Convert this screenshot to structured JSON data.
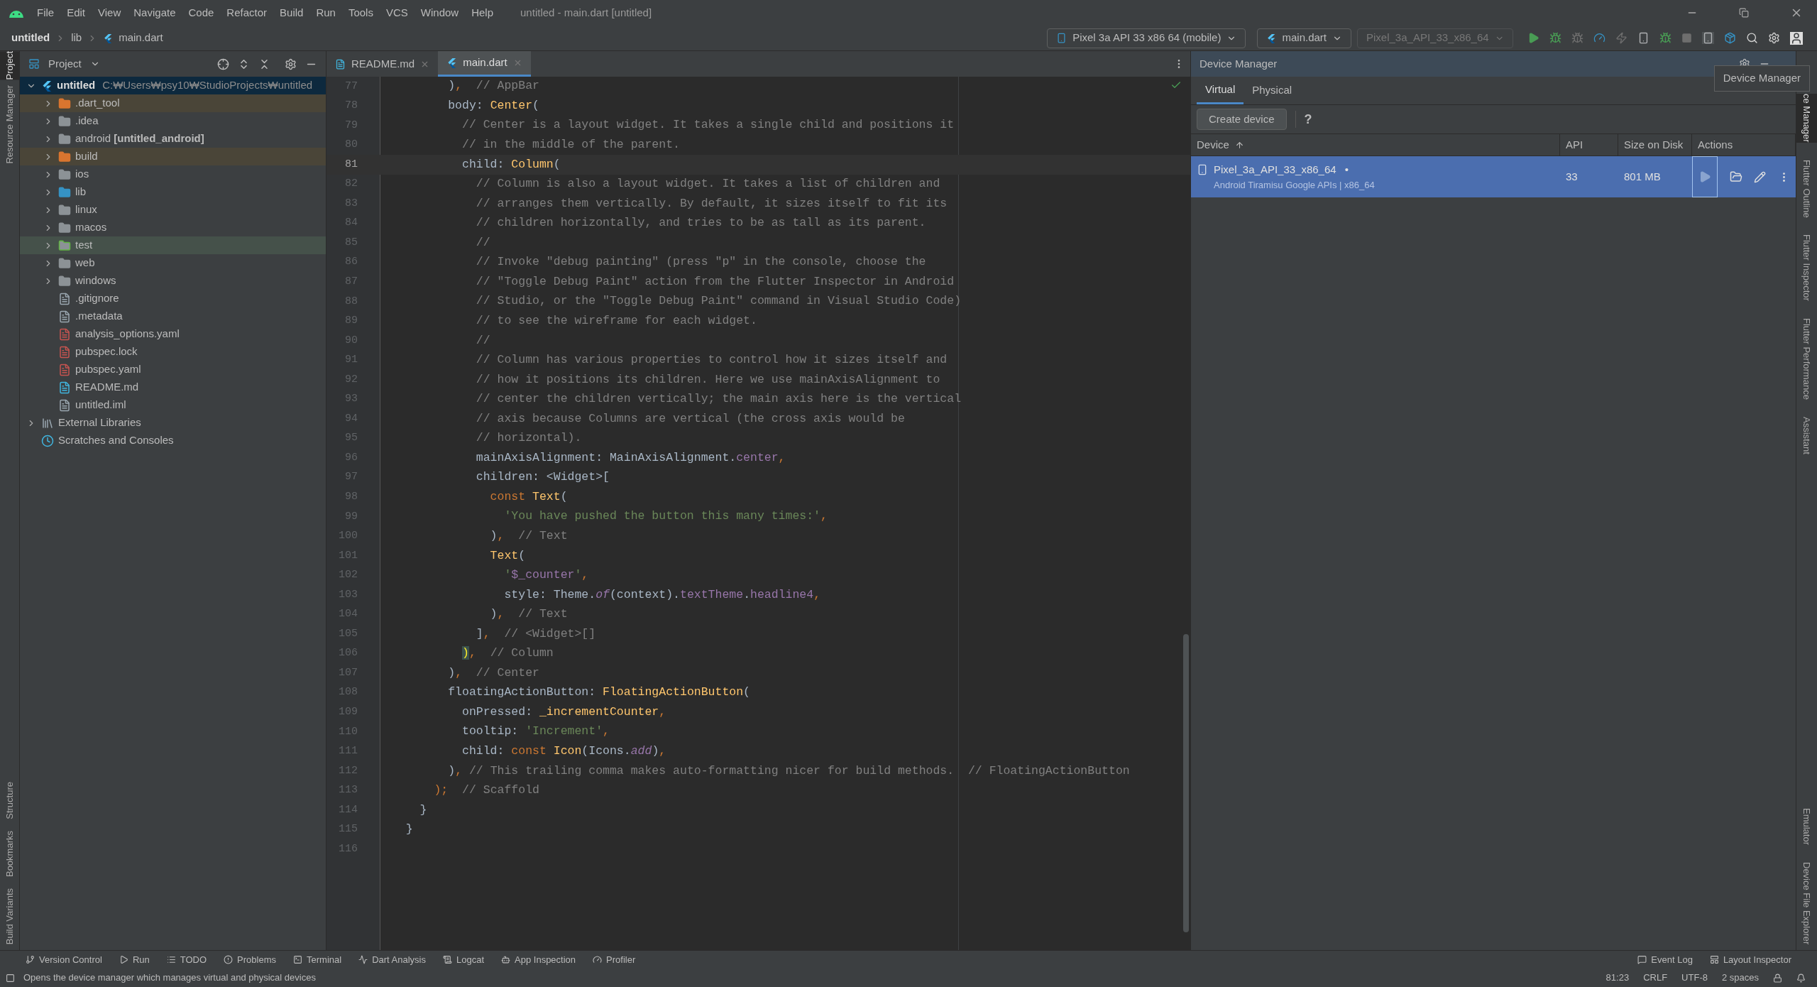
{
  "menu_bar": {
    "items": [
      "File",
      "Edit",
      "View",
      "Navigate",
      "Code",
      "Refactor",
      "Build",
      "Run",
      "Tools",
      "VCS",
      "Window",
      "Help"
    ],
    "title": "untitled - main.dart [untitled]"
  },
  "nav_bar": {
    "breadcrumbs": [
      "untitled",
      "lib",
      "main.dart"
    ],
    "device_select": "Pixel 3a API 33 x86 64 (mobile)",
    "config_select": "main.dart",
    "target_select": "Pixel_3a_API_33_x86_64"
  },
  "left_strip": {
    "top": [
      {
        "label": "Project",
        "selected": true
      },
      {
        "label": "Resource Manager",
        "selected": false
      }
    ],
    "bottom": [
      {
        "label": "Structure",
        "selected": false
      },
      {
        "label": "Bookmarks",
        "selected": false
      },
      {
        "label": "Build Variants",
        "selected": false
      }
    ]
  },
  "project_panel": {
    "title": "Project",
    "tree": [
      {
        "label": "untitled",
        "path": "C:₩Users₩psy10₩StudioProjects₩untitled",
        "kind": "flutter",
        "expanded": true,
        "selected": true,
        "children": [
          {
            "label": ".dart_tool",
            "kind": "excluded_folder",
            "expanded": false,
            "selected": false
          },
          {
            "label": ".idea",
            "kind": "folder",
            "expanded": false,
            "selected": false
          },
          {
            "label": "android **[untitled_android]**",
            "kind": "folder",
            "expanded": false,
            "selected": false
          },
          {
            "label": "build",
            "kind": "excluded_folder",
            "expanded": false,
            "selected": false
          },
          {
            "label": "ios",
            "kind": "folder",
            "expanded": false,
            "selected": false
          },
          {
            "label": "lib",
            "kind": "source",
            "expanded": false,
            "selected": false
          },
          {
            "label": "linux",
            "kind": "folder",
            "expanded": false,
            "selected": false
          },
          {
            "label": "macos",
            "kind": "folder",
            "expanded": false,
            "selected": false
          },
          {
            "label": "test",
            "kind": "test_folder",
            "expanded": false,
            "selected": false
          },
          {
            "label": "web",
            "kind": "folder",
            "expanded": false,
            "selected": false
          },
          {
            "label": "windows",
            "kind": "folder",
            "expanded": false,
            "selected": false
          },
          {
            "label": ".gitignore",
            "kind": "file",
            "selected": false
          },
          {
            "label": ".metadata",
            "kind": "file",
            "selected": false
          },
          {
            "label": "analysis_options.yaml",
            "kind": "yaml",
            "selected": false
          },
          {
            "label": "pubspec.lock",
            "kind": "yaml",
            "selected": false
          },
          {
            "label": "pubspec.yaml",
            "kind": "yaml",
            "selected": false
          },
          {
            "label": "README.md",
            "kind": "markdown",
            "selected": false
          },
          {
            "label": "untitled.iml",
            "kind": "file",
            "selected": false
          }
        ]
      },
      {
        "label": "External Libraries",
        "kind": "libraries",
        "expanded": false,
        "selected": false
      },
      {
        "label": "Scratches and Consoles",
        "kind": "scratches",
        "selected": false
      }
    ]
  },
  "editor": {
    "tabs": [
      {
        "label": "README.md",
        "kind": "markdown",
        "selected": false
      },
      {
        "label": "main.dart",
        "kind": "dart",
        "selected": true
      }
    ],
    "lines": [
      {
        "number": "77",
        "current": false,
        "tokens": [
          {
            "kind": "plain",
            "text": "        )"
          },
          {
            "kind": "keyword",
            "text": ","
          },
          {
            "kind": "comment",
            "text": "  // AppBar"
          }
        ]
      },
      {
        "number": "78",
        "current": false,
        "tokens": [
          {
            "kind": "plain",
            "text": "        body: "
          },
          {
            "kind": "class",
            "text": "Center"
          },
          {
            "kind": "plain",
            "text": "("
          }
        ]
      },
      {
        "number": "79",
        "current": false,
        "tokens": [
          {
            "kind": "comment",
            "text": "          // Center is a layout widget. It takes a single child and positions it"
          }
        ]
      },
      {
        "number": "80",
        "current": false,
        "tokens": [
          {
            "kind": "comment",
            "text": "          // in the middle of the parent."
          }
        ]
      },
      {
        "number": "81",
        "current": true,
        "tokens": [
          {
            "kind": "plain",
            "text": "          child: "
          },
          {
            "kind": "class",
            "text": "Column"
          },
          {
            "kind": "plain",
            "text": "("
          }
        ]
      },
      {
        "number": "82",
        "current": false,
        "tokens": [
          {
            "kind": "comment",
            "text": "            // Column is also a layout widget. It takes a list of children and"
          }
        ]
      },
      {
        "number": "83",
        "current": false,
        "tokens": [
          {
            "kind": "comment",
            "text": "            // arranges them vertically. By default, it sizes itself to fit its"
          }
        ]
      },
      {
        "number": "84",
        "current": false,
        "tokens": [
          {
            "kind": "comment",
            "text": "            // children horizontally, and tries to be as tall as its parent."
          }
        ]
      },
      {
        "number": "85",
        "current": false,
        "tokens": [
          {
            "kind": "comment",
            "text": "            //"
          }
        ]
      },
      {
        "number": "86",
        "current": false,
        "tokens": [
          {
            "kind": "comment",
            "text": "            // Invoke \"debug painting\" (press \"p\" in the console, choose the"
          }
        ]
      },
      {
        "number": "87",
        "current": false,
        "tokens": [
          {
            "kind": "comment",
            "text": "            // \"Toggle Debug Paint\" action from the Flutter Inspector in Android"
          }
        ]
      },
      {
        "number": "88",
        "current": false,
        "tokens": [
          {
            "kind": "comment",
            "text": "            // Studio, or the \"Toggle Debug Paint\" command in Visual Studio Code)"
          }
        ]
      },
      {
        "number": "89",
        "current": false,
        "tokens": [
          {
            "kind": "comment",
            "text": "            // to see the wireframe for each widget."
          }
        ]
      },
      {
        "number": "90",
        "current": false,
        "tokens": [
          {
            "kind": "comment",
            "text": "            //"
          }
        ]
      },
      {
        "number": "91",
        "current": false,
        "tokens": [
          {
            "kind": "comment",
            "text": "            // Column has various properties to control how it sizes itself and"
          }
        ]
      },
      {
        "number": "92",
        "current": false,
        "tokens": [
          {
            "kind": "comment",
            "text": "            // how it positions its children. Here we use mainAxisAlignment to"
          }
        ]
      },
      {
        "number": "93",
        "current": false,
        "tokens": [
          {
            "kind": "comment",
            "text": "            // center the children vertically; the main axis here is the vertical"
          }
        ]
      },
      {
        "number": "94",
        "current": false,
        "tokens": [
          {
            "kind": "comment",
            "text": "            // axis because Columns are vertical (the cross axis would be"
          }
        ]
      },
      {
        "number": "95",
        "current": false,
        "tokens": [
          {
            "kind": "comment",
            "text": "            // horizontal)."
          }
        ]
      },
      {
        "number": "96",
        "current": false,
        "tokens": [
          {
            "kind": "plain",
            "text": "            mainAxisAlignment: MainAxisAlignment."
          },
          {
            "kind": "member",
            "text": "center"
          },
          {
            "kind": "keyword",
            "text": ","
          }
        ]
      },
      {
        "number": "97",
        "current": false,
        "tokens": [
          {
            "kind": "plain",
            "text": "            children: <Widget>["
          }
        ]
      },
      {
        "number": "98",
        "current": false,
        "tokens": [
          {
            "kind": "keyword",
            "text": "              const "
          },
          {
            "kind": "class",
            "text": "Text"
          },
          {
            "kind": "plain",
            "text": "("
          }
        ]
      },
      {
        "number": "99",
        "current": false,
        "tokens": [
          {
            "kind": "string",
            "text": "                'You have pushed the button this many times:'"
          },
          {
            "kind": "keyword",
            "text": ","
          }
        ]
      },
      {
        "number": "100",
        "current": false,
        "tokens": [
          {
            "kind": "plain",
            "text": "              )"
          },
          {
            "kind": "keyword",
            "text": ","
          },
          {
            "kind": "comment",
            "text": "  // Text"
          }
        ]
      },
      {
        "number": "101",
        "current": false,
        "tokens": [
          {
            "kind": "class",
            "text": "              Text"
          },
          {
            "kind": "plain",
            "text": "("
          }
        ]
      },
      {
        "number": "102",
        "current": false,
        "tokens": [
          {
            "kind": "string",
            "text": "                '"
          },
          {
            "kind": "member",
            "text": "$_counter"
          },
          {
            "kind": "string",
            "text": "'"
          },
          {
            "kind": "keyword",
            "text": ","
          }
        ]
      },
      {
        "number": "103",
        "current": false,
        "tokens": [
          {
            "kind": "plain",
            "text": "                style: Theme."
          },
          {
            "kind": "static",
            "text": "of"
          },
          {
            "kind": "plain",
            "text": "(context)."
          },
          {
            "kind": "member",
            "text": "textTheme"
          },
          {
            "kind": "plain",
            "text": "."
          },
          {
            "kind": "member",
            "text": "headline4"
          },
          {
            "kind": "keyword",
            "text": ","
          }
        ]
      },
      {
        "number": "104",
        "current": false,
        "tokens": [
          {
            "kind": "plain",
            "text": "              )"
          },
          {
            "kind": "keyword",
            "text": ","
          },
          {
            "kind": "comment",
            "text": "  // Text"
          }
        ]
      },
      {
        "number": "105",
        "current": false,
        "tokens": [
          {
            "kind": "plain",
            "text": "            ]"
          },
          {
            "kind": "keyword",
            "text": ","
          },
          {
            "kind": "comment",
            "text": "  // <Widget>[]"
          }
        ]
      },
      {
        "number": "106",
        "current": false,
        "tokens": [
          {
            "kind": "bracket",
            "text": "          )"
          },
          {
            "kind": "keyword",
            "text": ","
          },
          {
            "kind": "comment",
            "text": "  // Column"
          }
        ]
      },
      {
        "number": "107",
        "current": false,
        "tokens": [
          {
            "kind": "plain",
            "text": "        )"
          },
          {
            "kind": "keyword",
            "text": ","
          },
          {
            "kind": "comment",
            "text": "  // Center"
          }
        ]
      },
      {
        "number": "108",
        "current": false,
        "tokens": [
          {
            "kind": "plain",
            "text": "        floatingActionButton: "
          },
          {
            "kind": "class",
            "text": "FloatingActionButton"
          },
          {
            "kind": "plain",
            "text": "("
          }
        ]
      },
      {
        "number": "109",
        "current": false,
        "tokens": [
          {
            "kind": "plain",
            "text": "          onPressed: "
          },
          {
            "kind": "class",
            "text": "_incrementCounter"
          },
          {
            "kind": "keyword",
            "text": ","
          }
        ]
      },
      {
        "number": "110",
        "current": false,
        "tokens": [
          {
            "kind": "plain",
            "text": "          tooltip: "
          },
          {
            "kind": "string",
            "text": "'Increment'"
          },
          {
            "kind": "keyword",
            "text": ","
          }
        ]
      },
      {
        "number": "111",
        "current": false,
        "tokens": [
          {
            "kind": "plain",
            "text": "          child: "
          },
          {
            "kind": "keyword",
            "text": "const "
          },
          {
            "kind": "class",
            "text": "Icon"
          },
          {
            "kind": "plain",
            "text": "(Icons."
          },
          {
            "kind": "static",
            "text": "add"
          },
          {
            "kind": "plain",
            "text": ")"
          },
          {
            "kind": "keyword",
            "text": ","
          }
        ]
      },
      {
        "number": "112",
        "current": false,
        "tokens": [
          {
            "kind": "plain",
            "text": "        )"
          },
          {
            "kind": "keyword",
            "text": ","
          },
          {
            "kind": "comment",
            "text": " // This trailing comma makes auto-formatting nicer for build methods.  // FloatingActionButton"
          }
        ]
      },
      {
        "number": "113",
        "current": false,
        "tokens": [
          {
            "kind": "keyword",
            "text": "      );"
          },
          {
            "kind": "comment",
            "text": "  // Scaffold"
          }
        ]
      },
      {
        "number": "114",
        "current": false,
        "tokens": [
          {
            "kind": "plain",
            "text": "    }"
          }
        ]
      },
      {
        "number": "115",
        "current": false,
        "tokens": [
          {
            "kind": "plain",
            "text": "  }"
          }
        ]
      },
      {
        "number": "116",
        "current": false
      }
    ]
  },
  "device_manager": {
    "title": "Device Manager",
    "tabs": [
      {
        "label": "Virtual",
        "selected": true
      },
      {
        "label": "Physical",
        "selected": false
      }
    ],
    "create_button": "Create device",
    "help": "?",
    "columns": [
      "Device",
      "API",
      "Size on Disk",
      "Actions"
    ],
    "rows": [
      {
        "name": "Pixel_3a_API_33_x86_64",
        "dot": "•",
        "subtitle": "Android Tiramisu Google APIs | x86_64",
        "api": "33",
        "size": "801 MB",
        "selected": true
      }
    ]
  },
  "tooltip": "Device Manager",
  "right_strip": {
    "top": [
      {
        "label": "ce Manager",
        "selected": true
      },
      {
        "label": "Flutter Outline",
        "selected": false
      },
      {
        "label": "Flutter Inspector",
        "selected": false
      },
      {
        "label": "Flutter Performance",
        "selected": false
      },
      {
        "label": "Assistant",
        "selected": false
      }
    ],
    "bottom": [
      {
        "label": "Emulator",
        "selected": false
      },
      {
        "label": "Device File Explorer",
        "selected": false
      }
    ]
  },
  "tool_bar": {
    "left": [
      "Version Control",
      "Run",
      "TODO",
      "Problems",
      "Terminal",
      "Dart Analysis",
      "Logcat",
      "App Inspection",
      "Profiler"
    ],
    "right": [
      "Event Log",
      "Layout Inspector"
    ]
  },
  "status_bar": {
    "message": "Opens the device manager which manages virtual and physical devices",
    "items": [
      "81:23",
      "CRLF",
      "UTF-8",
      "2 spaces"
    ]
  }
}
